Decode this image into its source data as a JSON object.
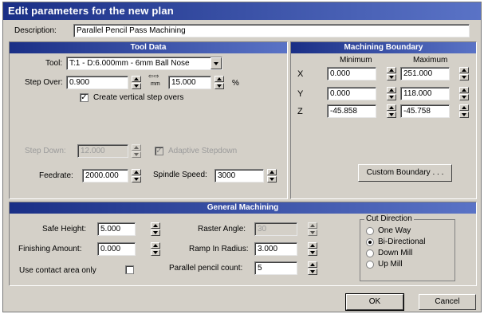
{
  "window": {
    "title": "Edit parameters for the new plan"
  },
  "description": {
    "label": "Description:",
    "value": "Parallel Pencil Pass Machining"
  },
  "tool_data": {
    "heading": "Tool Data",
    "tool_label": "Tool:",
    "tool_value": "T:1 - D:6.000mm - 6mm Ball Nose",
    "step_over_label": "Step Over:",
    "step_over_value": "0.900",
    "unit_mm": "mm",
    "step_over_percent_value": "15.000",
    "percent_sign": "%",
    "vertical_stepovers_label": "Create vertical step overs",
    "step_down_label": "Step Down:",
    "step_down_value": "12.000",
    "adaptive_stepdown_label": "Adaptive Stepdown",
    "feedrate_label": "Feedrate:",
    "feedrate_value": "2000.000",
    "spindle_label": "Spindle Speed:",
    "spindle_value": "3000"
  },
  "machining_boundary": {
    "heading": "Machining Boundary",
    "min_header": "Minimum",
    "max_header": "Maximum",
    "rows": [
      {
        "axis": "X",
        "min": "0.000",
        "max": "251.000"
      },
      {
        "axis": "Y",
        "min": "0.000",
        "max": "118.000"
      },
      {
        "axis": "Z",
        "min": "-45.858",
        "max": "-45.758"
      }
    ],
    "custom_button": "Custom Boundary . . ."
  },
  "general": {
    "heading": "General Machining",
    "safe_height_label": "Safe Height:",
    "safe_height_value": "5.000",
    "finishing_label": "Finishing Amount:",
    "finishing_value": "0.000",
    "contact_label": "Use contact area only",
    "raster_label": "Raster Angle:",
    "raster_value": "30",
    "ramp_label": "Ramp In Radius:",
    "ramp_value": "3.000",
    "pencil_label": "Parallel pencil count:",
    "pencil_value": "5",
    "cut_direction": {
      "title": "Cut Direction",
      "options": [
        "One Way",
        "Bi-Directional",
        "Down Mill",
        "Up Mill"
      ],
      "selected": "Bi-Directional"
    }
  },
  "buttons": {
    "ok": "OK",
    "cancel": "Cancel"
  }
}
